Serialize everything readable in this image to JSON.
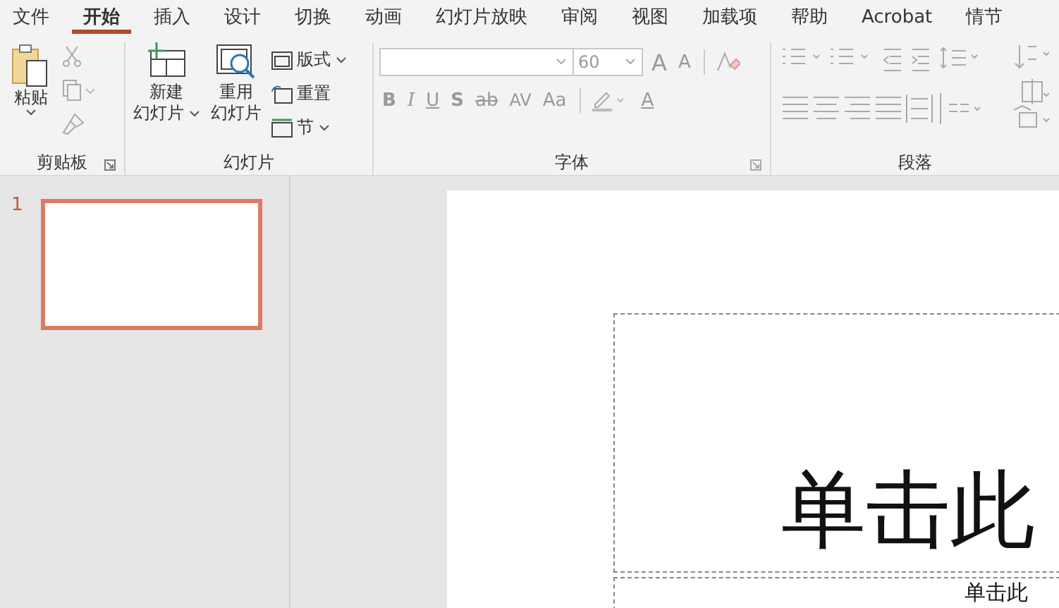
{
  "tabs": [
    {
      "label": "文件",
      "selected": false
    },
    {
      "label": "开始",
      "selected": true
    },
    {
      "label": "插入",
      "selected": false
    },
    {
      "label": "设计",
      "selected": false
    },
    {
      "label": "切换",
      "selected": false
    },
    {
      "label": "动画",
      "selected": false
    },
    {
      "label": "幻灯片放映",
      "selected": false
    },
    {
      "label": "审阅",
      "selected": false
    },
    {
      "label": "视图",
      "selected": false
    },
    {
      "label": "加载项",
      "selected": false
    },
    {
      "label": "帮助",
      "selected": false
    },
    {
      "label": "Acrobat",
      "selected": false
    },
    {
      "label": "情节",
      "selected": false
    }
  ],
  "clipboard": {
    "label": "剪贴板",
    "paste": "粘贴"
  },
  "slides_group": {
    "label": "幻灯片",
    "new_slide": [
      "新建",
      "幻灯片"
    ],
    "reuse": [
      "重用",
      "幻灯片"
    ],
    "layout": "版式",
    "reset": "重置",
    "section": "节"
  },
  "font": {
    "label": "字体",
    "size": "60",
    "grow": "A",
    "shrink": "A",
    "styles": [
      "B",
      "I",
      "U",
      "S",
      "ab",
      "AV",
      "Aa"
    ],
    "color_glyph": "A"
  },
  "paragraph": {
    "label": "段落"
  },
  "thumbnails": [
    {
      "number": "1",
      "selected": true
    }
  ],
  "slide": {
    "title": "单击此",
    "subtitle": "单击此"
  }
}
